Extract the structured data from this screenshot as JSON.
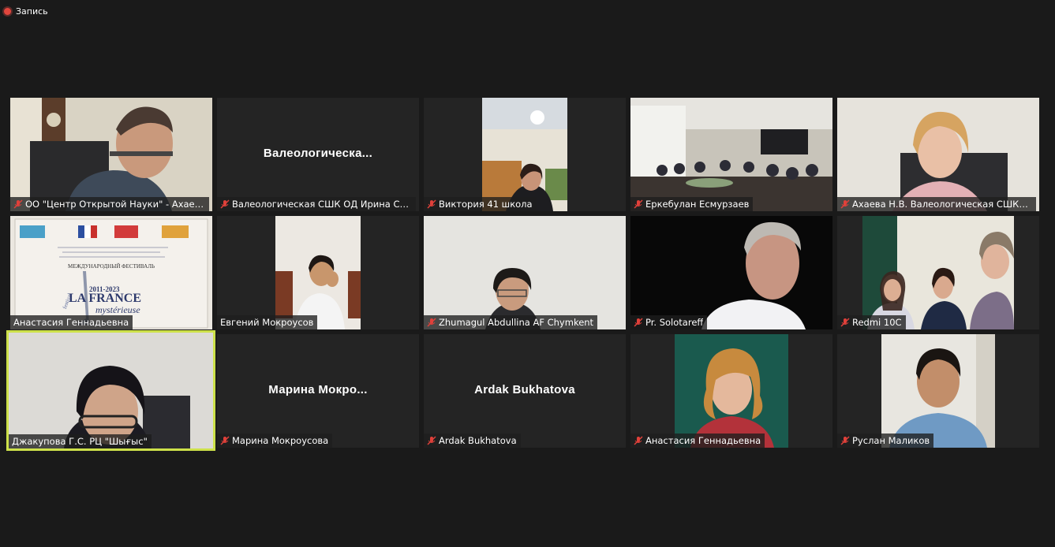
{
  "recording": {
    "label": "Запись"
  },
  "tiles": [
    {
      "name": "ОО \"Центр Открытой Науки\" - Ахаев...",
      "muted": true,
      "display_name": ""
    },
    {
      "name": "Валеологическая СШК ОД Ирина Ст...",
      "muted": true,
      "display_name": "Валеологическа..."
    },
    {
      "name": "Виктория 41 школа",
      "muted": true,
      "display_name": ""
    },
    {
      "name": "Еркебулан Есмурзаев",
      "muted": true,
      "display_name": ""
    },
    {
      "name": "Ахаева Н.В. Валеологическая СШКО...",
      "muted": true,
      "display_name": ""
    },
    {
      "name": "Анастасия Геннадьевна",
      "muted": false,
      "display_name": ""
    },
    {
      "name": "Евгений Мокроусов",
      "muted": false,
      "display_name": ""
    },
    {
      "name": "Zhumagul Abdullina AF Chymkent",
      "muted": true,
      "display_name": ""
    },
    {
      "name": "Pr. Solotareff",
      "muted": true,
      "display_name": ""
    },
    {
      "name": "Redmi 10C",
      "muted": true,
      "display_name": ""
    },
    {
      "name": "Джакупова Г.С. РЦ \"Шығыс\"",
      "muted": false,
      "display_name": ""
    },
    {
      "name": "Марина Мокроусова",
      "muted": true,
      "display_name": "Марина  Мокро..."
    },
    {
      "name": "Ardak Bukhatova",
      "muted": true,
      "display_name": "Ardak Bukhatova"
    },
    {
      "name": "Анастасия Геннадьевна",
      "muted": true,
      "display_name": ""
    },
    {
      "name": "Руслан Маликов",
      "muted": true,
      "display_name": ""
    }
  ],
  "shared_slide": {
    "header": "МЕЖДУНАРОДНЫЙ ФЕСТИВАЛЬ",
    "years": "2011-2023",
    "title": "LA FRANCE",
    "subtitle": "mystérieuse",
    "festival": "festival"
  },
  "colors": {
    "background": "#1a1a1a",
    "tile": "#242424",
    "active_speaker": "#cde14a",
    "recording": "#e2463d",
    "muted_mic": "#e0403a"
  }
}
